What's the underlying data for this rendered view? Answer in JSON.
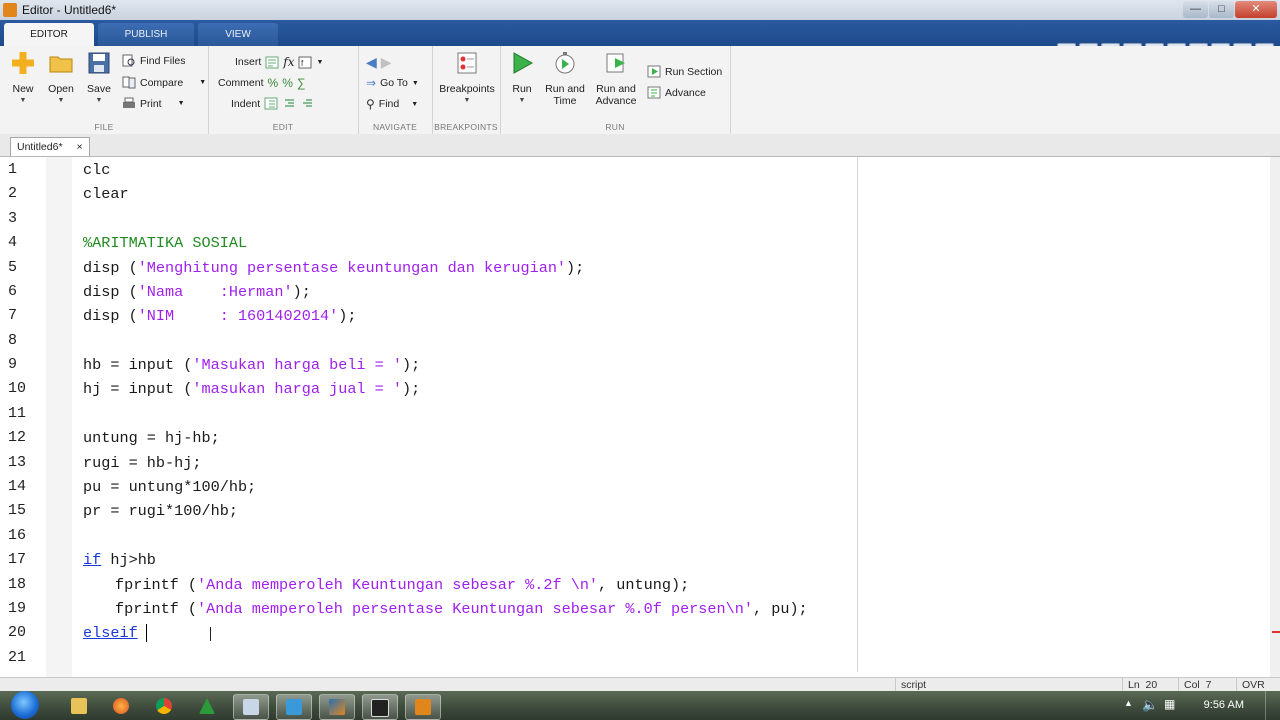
{
  "window": {
    "title": "Editor - Untitled6*"
  },
  "ribbon_tabs": [
    "EDITOR",
    "PUBLISH",
    "VIEW"
  ],
  "file_group": {
    "label": "FILE",
    "new": "New",
    "open": "Open",
    "save": "Save",
    "find_files": "Find Files",
    "compare": "Compare",
    "print": "Print"
  },
  "edit_group": {
    "label": "EDIT",
    "insert": "Insert",
    "comment": "Comment",
    "indent": "Indent",
    "fx": "fx"
  },
  "navigate_group": {
    "label": "NAVIGATE",
    "go_to": "Go To",
    "find": "Find"
  },
  "breakpoints_group": {
    "label": "BREAKPOINTS",
    "breakpoints": "Breakpoints"
  },
  "run_group": {
    "label": "RUN",
    "run": "Run",
    "run_and_time_1": "Run and",
    "run_and_time_2": "Time",
    "run_and_advance_1": "Run and",
    "run_and_advance_2": "Advance",
    "run_section": "Run Section",
    "advance": "Advance"
  },
  "document_tab": {
    "name": "Untitled6*",
    "close": "×"
  },
  "code_lines": [
    "clc",
    "clear",
    "",
    "%ARITMATIKA SOSIAL",
    "disp ('Menghitung persentase keuntungan dan kerugian');",
    "disp ('Nama    :Herman');",
    "disp ('NIM     : 1601402014');",
    "",
    "hb = input ('Masukan harga beli = ');",
    "hj = input ('masukan harga jual = ');",
    "",
    "untung = hj-hb;",
    "rugi = hb-hj;",
    "pu = untung*100/hb;",
    "pr = rugi*100/hb;",
    "",
    "if hj>hb",
    "   fprintf ('Anda memperoleh Keuntungan sebesar %.2f \\n', untung);",
    "   fprintf ('Anda memperoleh persentase Keuntungan sebesar %.0f persen\\n', pu);",
    "elseif",
    ""
  ],
  "status_bar": {
    "mode": "script",
    "ln_label": "Ln",
    "ln_value": "20",
    "col_label": "Col",
    "col_value": "7",
    "ovr": "OVR"
  },
  "taskbar": {
    "clock": "9:56 AM"
  },
  "colors": {
    "string": "#a020f0",
    "comment": "#228b22",
    "keyword": "#1a3ad6",
    "ribbon_tab_bar": "#1d4a8a"
  }
}
